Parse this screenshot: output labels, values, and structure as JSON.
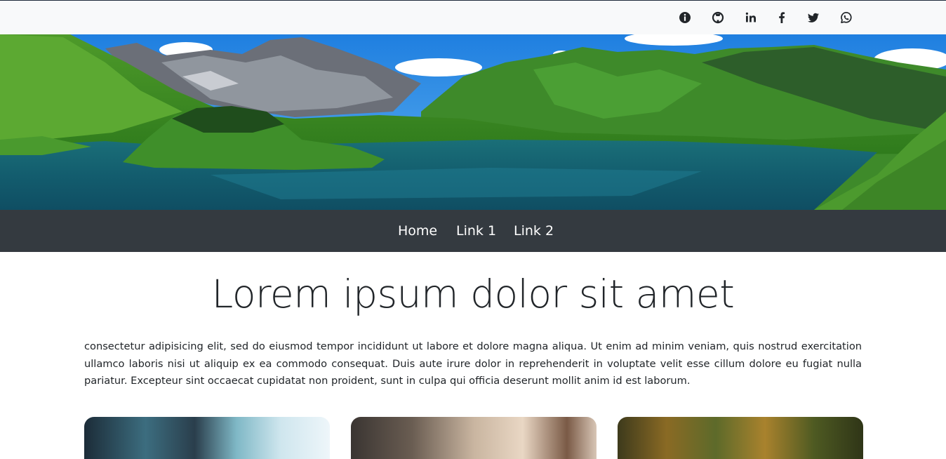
{
  "social_links": [
    {
      "icon": "info-icon"
    },
    {
      "icon": "github-icon"
    },
    {
      "icon": "linkedin-icon"
    },
    {
      "icon": "facebook-icon"
    },
    {
      "icon": "twitter-icon"
    },
    {
      "icon": "whatsapp-icon"
    }
  ],
  "nav": {
    "items": [
      {
        "label": "Home"
      },
      {
        "label": "Link 1"
      },
      {
        "label": "Link 2"
      }
    ]
  },
  "main": {
    "title": "Lorem ipsum dolor sit amet",
    "intro": "consectetur adipisicing elit, sed do eiusmod tempor incididunt ut labore et dolore magna aliqua. Ut enim ad minim veniam, quis nostrud exercitation ullamco laboris nisi ut aliquip ex ea commodo consequat. Duis aute irure dolor in reprehenderit in voluptate velit esse cillum dolore eu fugiat nulla pariatur. Excepteur sint occaecat cupidatat non proident, sunt in culpa qui officia deserunt mollit anim id est laborum."
  },
  "colors": {
    "topbar_bg": "#f8f9fa",
    "navbar_bg": "#343a40",
    "text": "#212529",
    "nav_text": "#ffffff"
  }
}
